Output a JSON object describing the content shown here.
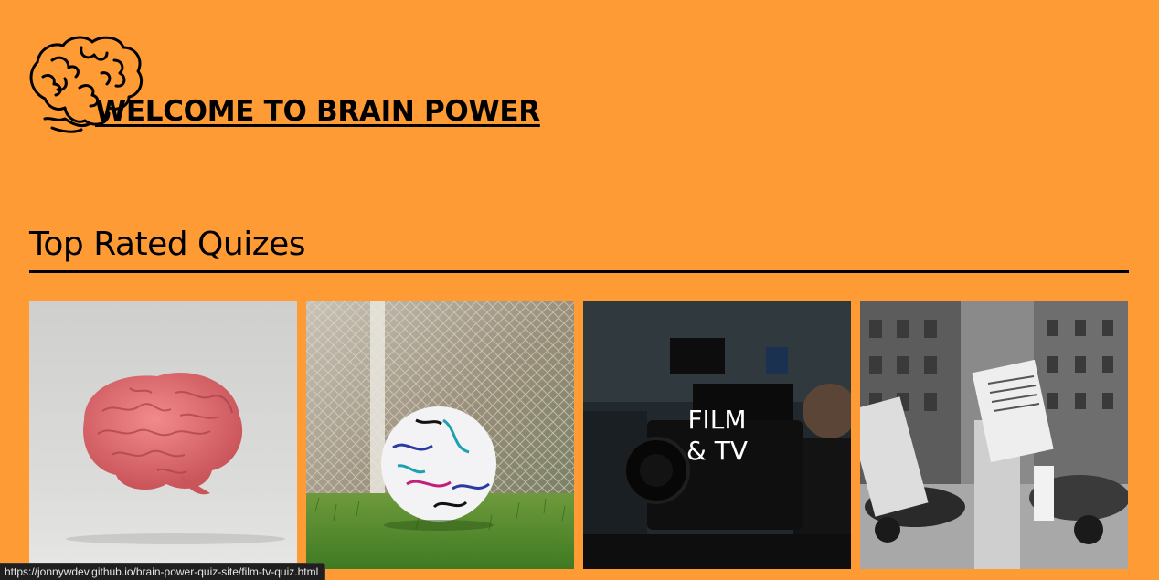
{
  "header": {
    "title": "WELCOME TO BRAIN POWER",
    "logo_icon": "brain-outline-icon"
  },
  "section": {
    "title": "Top Rated Quizes"
  },
  "quizzes": [
    {
      "image": "pink-brain-photo",
      "label": ""
    },
    {
      "image": "soccer-ball-photo",
      "label": ""
    },
    {
      "image": "film-camera-photo",
      "label": "FILM\n& TV",
      "hovered": true
    },
    {
      "image": "newspaper-reader-photo",
      "label": ""
    }
  ],
  "status_bar": {
    "url": "https://jonnywdev.github.io/brain-power-quiz-site/film-tv-quiz.html"
  },
  "colors": {
    "background": "#FF9B35",
    "text": "#000000",
    "overlay_text": "#FFFFFF"
  }
}
